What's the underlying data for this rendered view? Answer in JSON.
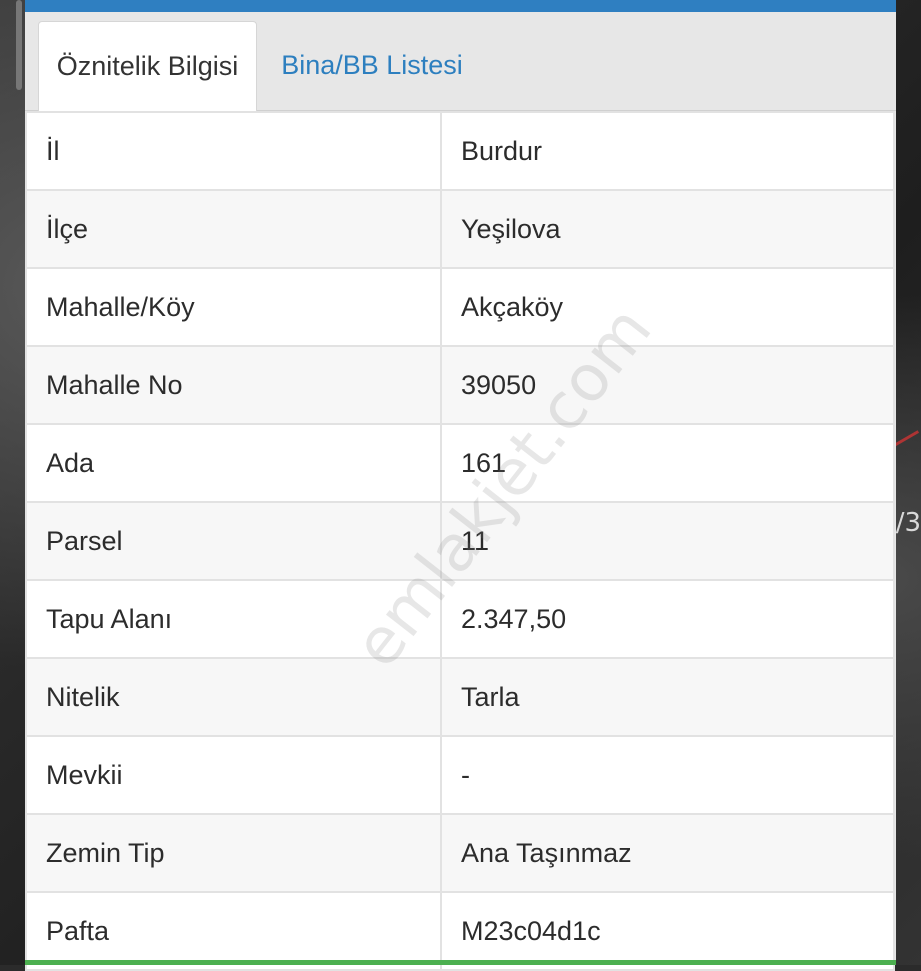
{
  "tabs": [
    {
      "label": "Öznitelik Bilgisi",
      "active": true
    },
    {
      "label": "Bina/BB Listesi",
      "active": false
    }
  ],
  "rows": [
    {
      "key": "İl",
      "value": "Burdur"
    },
    {
      "key": "İlçe",
      "value": "Yeşilova"
    },
    {
      "key": "Mahalle/Köy",
      "value": "Akçaköy"
    },
    {
      "key": "Mahalle No",
      "value": "39050"
    },
    {
      "key": "Ada",
      "value": "161"
    },
    {
      "key": "Parsel",
      "value": "11"
    },
    {
      "key": "Tapu Alanı",
      "value": "2.347,50"
    },
    {
      "key": "Nitelik",
      "value": "Tarla"
    },
    {
      "key": "Mevkii",
      "value": "-"
    },
    {
      "key": "Zemin Tip",
      "value": "Ana Taşınmaz"
    },
    {
      "key": "Pafta",
      "value": "M23c04d1c"
    }
  ],
  "watermark": "emlakjet.com",
  "map_label": "/3",
  "colors": {
    "topbar": "#2f7fc1",
    "link": "#2d7fbf",
    "bottom": "#4caf50"
  }
}
